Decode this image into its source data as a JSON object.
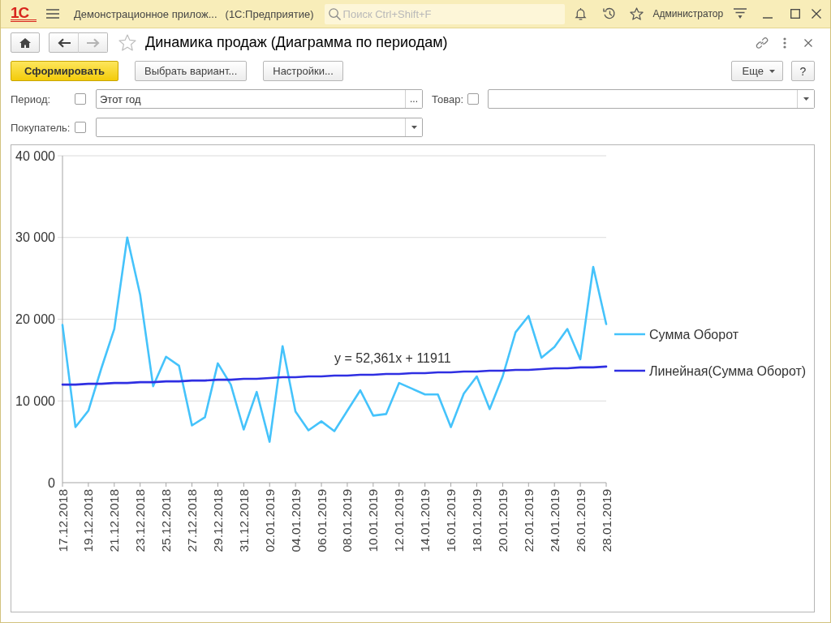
{
  "app_bar": {
    "logo": "1С",
    "app_title": "Демонстрационное прилож...",
    "platform": "(1С:Предприятие)",
    "search": {
      "placeholder": "Поиск Ctrl+Shift+F"
    },
    "user": "Администратор"
  },
  "form": {
    "nav": [
      {
        "kind": "back",
        "disabled": false
      },
      {
        "kind": "forward",
        "disabled": true
      }
    ],
    "favorite": false,
    "title": "Динамика продаж (Диаграмма по периодам)",
    "toolbar": {
      "buttons": [
        {
          "label": "Сформировать",
          "kind": "primary"
        },
        {
          "label": "Выбрать вариант...",
          "kind": "plain"
        },
        {
          "label": "Настройки...",
          "kind": "plain"
        }
      ],
      "more": "Еще",
      "help": "?"
    },
    "filters": [
      {
        "label": "Период:",
        "checked": false,
        "kind": "choice",
        "value": "Этот год",
        "choice_button": "..."
      },
      {
        "label": "Товар:",
        "checked": false,
        "kind": "dropdown"
      },
      {
        "label": "Покупатель:",
        "checked": false,
        "kind": "dropdown"
      }
    ],
    "chart": {
      "chart_data": {
        "type": "line",
        "categories": [
          "17.12.2018",
          null,
          "19.12.2018",
          null,
          "21.12.2018",
          null,
          "23.12.2018",
          null,
          "25.12.2018",
          null,
          "27.12.2018",
          null,
          "29.12.2018",
          null,
          "31.12.2018",
          null,
          "02.01.2019",
          null,
          "04.01.2019",
          null,
          "06.01.2019",
          null,
          "08.01.2019",
          null,
          "10.01.2019",
          null,
          "12.01.2019",
          null,
          "14.01.2019",
          null,
          "16.01.2019",
          null,
          "18.01.2019",
          null,
          "20.01.2019",
          null,
          "22.01.2019",
          null,
          "24.01.2019",
          null,
          "26.01.2019",
          null,
          "28.01.2019"
        ],
        "ylim": [
          0,
          40000
        ],
        "yticks": [
          {
            "value": 0,
            "label": "0"
          },
          {
            "value": 10000,
            "label": "10 000"
          },
          {
            "value": 20000,
            "label": "20 000"
          },
          {
            "value": 30000,
            "label": "30 000"
          },
          {
            "value": 40000,
            "label": "40 000"
          }
        ],
        "grid": true,
        "legend": "right",
        "series": [
          {
            "name": "Сумма Оборот",
            "color": "#45c3fb",
            "values": [
              19300,
              6800,
              8800,
              14000,
              18800,
              30000,
              23000,
              11800,
              15400,
              14300,
              7000,
              8000,
              14600,
              12000,
              6500,
              11100,
              5000,
              16700,
              8700,
              6400,
              7500,
              6300,
              8800,
              11300,
              8200,
              8400,
              12200,
              11500,
              10800,
              10800,
              6800,
              10900,
              13000,
              9000,
              13000,
              18400,
              20400,
              15300,
              16600,
              18800,
              15100,
              26400,
              19400
            ]
          },
          {
            "name": "Линейная(Сумма Оборот)",
            "color": "#2f2fe2",
            "values": [
              12000,
              12000,
              12100,
              12100,
              12200,
              12200,
              12300,
              12300,
              12400,
              12400,
              12500,
              12500,
              12600,
              12600,
              12700,
              12700,
              12800,
              12900,
              12900,
              13000,
              13000,
              13100,
              13100,
              13200,
              13200,
              13300,
              13300,
              13400,
              13400,
              13500,
              13500,
              13600,
              13600,
              13700,
              13700,
              13800,
              13800,
              13900,
              14000,
              14000,
              14100,
              14100,
              14200
            ]
          }
        ],
        "annotations": [
          "y = 52,361x + 11911"
        ]
      }
    }
  }
}
